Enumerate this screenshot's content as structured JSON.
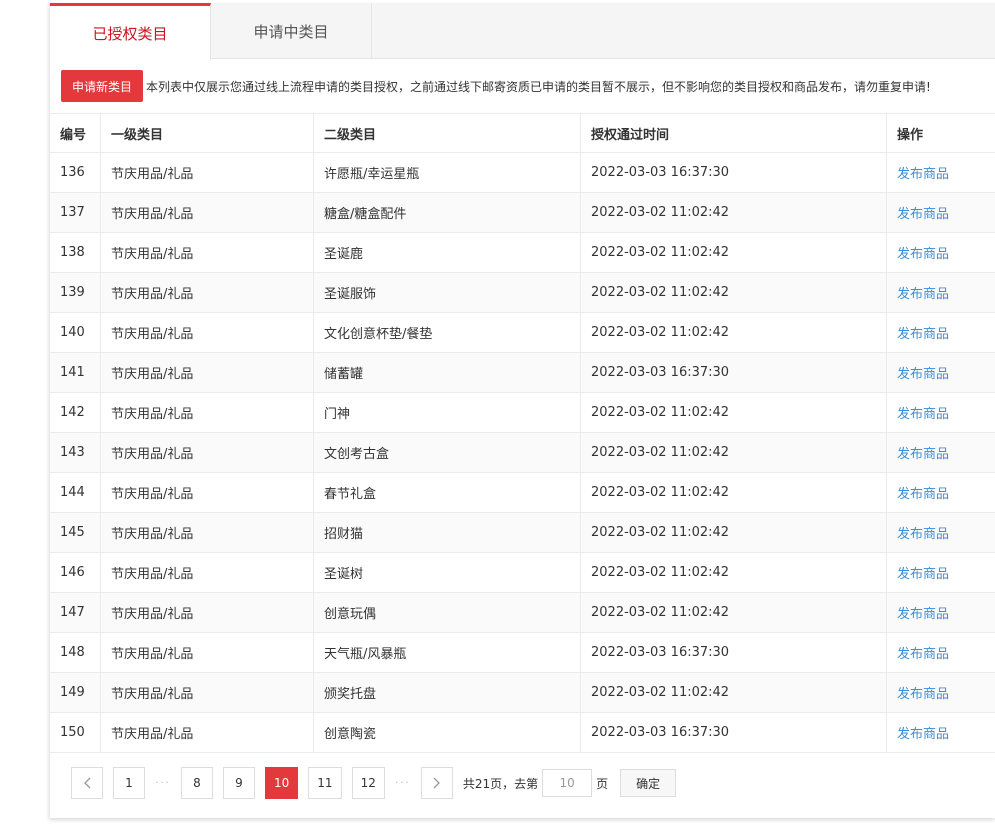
{
  "tabs": [
    {
      "label": "已授权类目"
    },
    {
      "label": "申请中类目"
    }
  ],
  "notice": {
    "apply_button": "申请新类目",
    "text": "本列表中仅展示您通过线上流程申请的类目授权，之前通过线下邮寄资质已申请的类目暂不展示，但不影响您的类目授权和商品发布，请勿重复申请!"
  },
  "table": {
    "headers": [
      "编号",
      "一级类目",
      "二级类目",
      "授权通过时间",
      "操作"
    ],
    "rows": [
      {
        "id": "136",
        "cat1": "节庆用品/礼品",
        "cat2": "许愿瓶/幸运星瓶",
        "time": "2022-03-03 16:37:30",
        "action": "发布商品"
      },
      {
        "id": "137",
        "cat1": "节庆用品/礼品",
        "cat2": "糖盒/糖盒配件",
        "time": "2022-03-02 11:02:42",
        "action": "发布商品"
      },
      {
        "id": "138",
        "cat1": "节庆用品/礼品",
        "cat2": "圣诞鹿",
        "time": "2022-03-02 11:02:42",
        "action": "发布商品"
      },
      {
        "id": "139",
        "cat1": "节庆用品/礼品",
        "cat2": "圣诞服饰",
        "time": "2022-03-02 11:02:42",
        "action": "发布商品"
      },
      {
        "id": "140",
        "cat1": "节庆用品/礼品",
        "cat2": "文化创意杯垫/餐垫",
        "time": "2022-03-02 11:02:42",
        "action": "发布商品"
      },
      {
        "id": "141",
        "cat1": "节庆用品/礼品",
        "cat2": "储蓄罐",
        "time": "2022-03-03 16:37:30",
        "action": "发布商品"
      },
      {
        "id": "142",
        "cat1": "节庆用品/礼品",
        "cat2": "门神",
        "time": "2022-03-02 11:02:42",
        "action": "发布商品"
      },
      {
        "id": "143",
        "cat1": "节庆用品/礼品",
        "cat2": "文创考古盒",
        "time": "2022-03-02 11:02:42",
        "action": "发布商品"
      },
      {
        "id": "144",
        "cat1": "节庆用品/礼品",
        "cat2": "春节礼盒",
        "time": "2022-03-02 11:02:42",
        "action": "发布商品"
      },
      {
        "id": "145",
        "cat1": "节庆用品/礼品",
        "cat2": "招财猫",
        "time": "2022-03-02 11:02:42",
        "action": "发布商品"
      },
      {
        "id": "146",
        "cat1": "节庆用品/礼品",
        "cat2": "圣诞树",
        "time": "2022-03-02 11:02:42",
        "action": "发布商品"
      },
      {
        "id": "147",
        "cat1": "节庆用品/礼品",
        "cat2": "创意玩偶",
        "time": "2022-03-02 11:02:42",
        "action": "发布商品"
      },
      {
        "id": "148",
        "cat1": "节庆用品/礼品",
        "cat2": "天气瓶/风暴瓶",
        "time": "2022-03-03 16:37:30",
        "action": "发布商品"
      },
      {
        "id": "149",
        "cat1": "节庆用品/礼品",
        "cat2": "颁奖托盘",
        "time": "2022-03-02 11:02:42",
        "action": "发布商品"
      },
      {
        "id": "150",
        "cat1": "节庆用品/礼品",
        "cat2": "创意陶瓷",
        "time": "2022-03-03 16:37:30",
        "action": "发布商品"
      }
    ]
  },
  "pagination": {
    "prev_icon": "chevron-left-icon",
    "next_icon": "chevron-right-icon",
    "pages_before": [
      "1"
    ],
    "ellipsis": "···",
    "pages_middle": [
      "8",
      "9"
    ],
    "current": "10",
    "pages_after": [
      "11",
      "12"
    ],
    "total_text": "共21页，去第",
    "goto_value": "10",
    "page_suffix": "页",
    "confirm": "确定"
  },
  "colors": {
    "accent": "#e4393c",
    "link": "#3b8dd6"
  }
}
